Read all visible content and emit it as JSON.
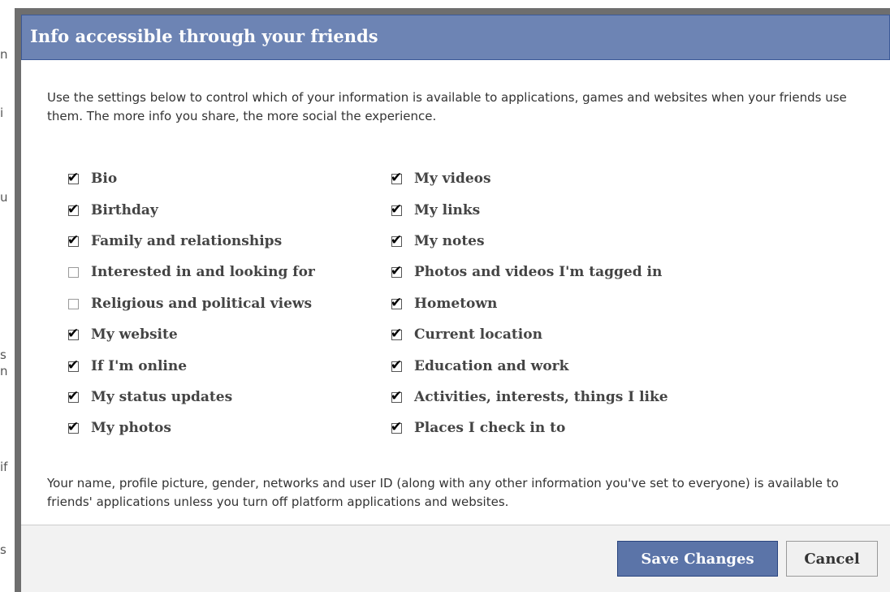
{
  "background_fragments": [
    "n",
    "i",
    "u",
    "s",
    "n",
    "if",
    "s"
  ],
  "dialog": {
    "title": "Info accessible through your friends",
    "intro": "Use the settings below to control which of your information is available to applications, games and websites when your friends use them. The more info you share, the more social the experience.",
    "left_items": [
      {
        "label": "Bio",
        "checked": true
      },
      {
        "label": "Birthday",
        "checked": true
      },
      {
        "label": "Family and relationships",
        "checked": true
      },
      {
        "label": "Interested in and looking for",
        "checked": false
      },
      {
        "label": "Religious and political views",
        "checked": false
      },
      {
        "label": "My website",
        "checked": true
      },
      {
        "label": "If I'm online",
        "checked": true
      },
      {
        "label": "My status updates",
        "checked": true
      },
      {
        "label": "My photos",
        "checked": true
      }
    ],
    "right_items": [
      {
        "label": "My videos",
        "checked": true
      },
      {
        "label": "My links",
        "checked": true
      },
      {
        "label": "My notes",
        "checked": true
      },
      {
        "label": "Photos and videos I'm tagged in",
        "checked": true
      },
      {
        "label": "Hometown",
        "checked": true
      },
      {
        "label": "Current location",
        "checked": true
      },
      {
        "label": "Education and work",
        "checked": true
      },
      {
        "label": "Activities, interests, things I like",
        "checked": true
      },
      {
        "label": "Places I check in to",
        "checked": true
      }
    ],
    "footer_note": "Your name, profile picture, gender, networks and user ID (along with any other information you've set to everyone) is available to friends' applications unless you turn off platform applications and websites.",
    "save_label": "Save Changes",
    "cancel_label": "Cancel"
  },
  "colors": {
    "header_bg": "#6d84b4",
    "save_bg": "#5b74a8"
  }
}
